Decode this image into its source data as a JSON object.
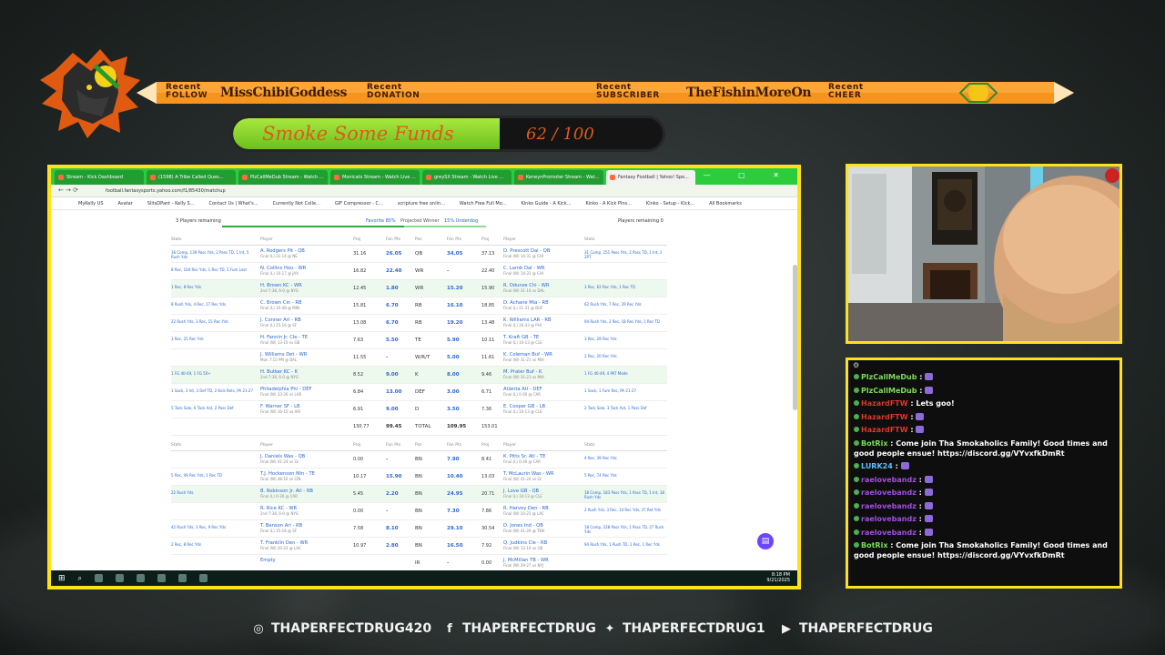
{
  "banner": {
    "follow_label": [
      "Recent",
      "FOLLOW"
    ],
    "follow_name": "MissChibiGoddess",
    "donation_label": [
      "Recent",
      "DONATION"
    ],
    "subscriber_label": [
      "Recent",
      "SUBSCRIBER"
    ],
    "subscriber_name": "TheFishinMoreOn",
    "cheer_label": [
      "Recent",
      "CHEER"
    ]
  },
  "goal": {
    "title": "Smoke Some Funds",
    "current": 62,
    "target": 100,
    "count_text": "62 / 100",
    "fill_fraction": 0.62
  },
  "browser": {
    "tabs": [
      "Stream - Kick Dashboard",
      "(1598) A Tribe Called Ques...",
      "PlzCallMeDub Stream - Watch ...",
      "Monicats Stream - Watch Live ...",
      "greySX Stream - Watch Live ...",
      "KerwynPromoter Stream - Wat...",
      "Fantasy Football | Yahoo! Spo..."
    ],
    "url": "football.fantasysports.yahoo.com/f1/85430/matchup",
    "bookmarks": [
      "MyKelly US",
      "Avatar",
      "SlitsDPant - Kelly S...",
      "Contact Us | What's...",
      "Currently Not Colle...",
      "GIF Compressor - C...",
      "scripture free onlin...",
      "Watch Free Full Mo...",
      "Kinko Guide - A Kick...",
      "Kinko - A Kick Plns...",
      "Kinko - Setup - Kick...",
      "All Bookmarks"
    ],
    "summary": {
      "left": "3 Players remaining",
      "favorite": "Favorite 85%",
      "projected": "Projected Winner",
      "underdog": "15% Underdog",
      "right": "Players remaining 0"
    },
    "headers": {
      "stats": "Stats",
      "player": "Player",
      "proj": "Proj",
      "fan_pts": "Fan Pts",
      "pos": "Pos"
    },
    "starters": [
      {
        "lstats": "16 Comp, 139 Pass Yds, 2 Pass TD, 1 Int, 5 Rush Yds",
        "lname": "A. Rodgers Pit - QB",
        "lgame": "Final (L) 21-14 @ NE",
        "lproj": "31.16",
        "lpts": "26.05",
        "pos": "QB",
        "rpts": "34.05",
        "rproj": "37.13",
        "rname": "D. Prescott Dal - QB",
        "rgame": "Final (W) 14-31 @ CHI",
        "rstats": "31 Comp, 251 Pass Yds, 2 Pass TD, 1 Int, 1 2PT"
      },
      {
        "lstats": "8 Rec, 104 Rec Yds, 1 Rec TD, 1 Fum Lost",
        "lname": "N. Collins Hou - WR",
        "lgame": "Final (L) 10-17 @ JAX",
        "lproj": "16.82",
        "lpts": "22.40",
        "pos": "WR",
        "rpts": "-",
        "rproj": "22.40",
        "rname": "C. Lamb Dal - WR",
        "rgame": "Final (W) 14-31 @ CHI",
        "rstats": ""
      },
      {
        "lstats": "1 Rec, 8 Rec Yds",
        "lname": "H. Brown KC - WR",
        "lgame": "2nd 7:38, 6-0 @ NYG",
        "lproj": "12.45",
        "lpts": "1.80",
        "pos": "WR",
        "rpts": "15.20",
        "rproj": "15.90",
        "rname": "R. Odunze Chi - WR",
        "rgame": "Final (W) 31-14 vs DAL",
        "rstats": "3 Rec, 62 Rec Yds, 1 Rec TD"
      },
      {
        "lstats": "8 Rush Yds, 4 Rec, 17 Rec Yds",
        "lname": "C. Brown Cin - RB",
        "lgame": "Final (L) 10-48 @ MIN",
        "lproj": "15.81",
        "lpts": "6.70",
        "pos": "RB",
        "rpts": "16.10",
        "rproj": "18.85",
        "rname": "D. Achane Mia - RB",
        "rgame": "Final (L) 21-31 @ BUF",
        "rstats": "62 Rush Yds, 7 Rec, 29 Rec Yds"
      },
      {
        "lstats": "22 Rush Yds, 3 Rec, 15 Rec Yds",
        "lname": "J. Conner Ari - RB",
        "lgame": "Final (L) 15-16 @ SF",
        "lproj": "13.08",
        "lpts": "6.70",
        "pos": "RB",
        "rpts": "19.20",
        "rproj": "13.48",
        "rname": "K. Williams LAR - RB",
        "rgame": "Final (L) 26-33 @ PHI",
        "rstats": "94 Rush Yds, 2 Rec, 18 Rec Yds, 1 Rec TD"
      },
      {
        "lstats": "3 Rec, 25 Rec Yds",
        "lname": "H. Fannin Jr. Cle - TE",
        "lgame": "Final (W) 13-10 vs GB",
        "lproj": "7.63",
        "lpts": "5.50",
        "pos": "TE",
        "rpts": "5.90",
        "rproj": "10.11",
        "rname": "T. Kraft GB - TE",
        "rgame": "Final (L) 10-13 @ CLE",
        "rstats": "3 Rec, 29 Rec Yds"
      },
      {
        "lstats": "",
        "lname": "J. Williams Det - WR",
        "lgame": "Mon 7:15 PM @ BAL",
        "lproj": "11.55",
        "lpts": "-",
        "pos": "W/R/T",
        "rpts": "5.00",
        "rproj": "11.61",
        "rname": "K. Coleman Buf - WR",
        "rgame": "Final (W) 31-21 vs MIA",
        "rstats": "2 Rec, 20 Rec Yds"
      },
      {
        "lstats": "1 FG 40-49, 1 FG 50+",
        "lname": "H. Butker KC - K",
        "lgame": "2nd 7:38, 6-0 @ NYG",
        "lproj": "8.52",
        "lpts": "9.00",
        "pos": "K",
        "rpts": "8.00",
        "rproj": "9.46",
        "rname": "M. Prater Buf - K",
        "rgame": "Final (W) 31-21 vs MIA",
        "rstats": "1 FG 40-49, 4 PAT Made"
      },
      {
        "lstats": "1 Sack, 3 Int, 3 Def TD, 2 Kick Rets, PA 21-27",
        "lname": "Philadelphia Phi - DEF",
        "lgame": "Final (W) 33-26 vs LAR",
        "lproj": "6.84",
        "lpts": "13.00",
        "pos": "DEF",
        "rpts": "3.00",
        "rproj": "6.71",
        "rname": "Atlanta Atl - DEF",
        "rgame": "Final (L) 0-30 @ CAR",
        "rstats": "1 Sack, 1 Fum Rec, PA 21-27"
      },
      {
        "lstats": "5 Tack Solo, 6 Tack Ast, 2 Pass Def",
        "lname": "F. Warner SF - LB",
        "lgame": "Final (W) 16-15 vs ARI",
        "lproj": "6.91",
        "lpts": "9.00",
        "pos": "D",
        "rpts": "3.50",
        "rproj": "7.36",
        "rname": "E. Cooper GB - LB",
        "rgame": "Final (L) 10-13 @ CLE",
        "rstats": "2 Tack Solo, 3 Tack Ast, 1 Pass Def"
      }
    ],
    "totals": {
      "lproj": "130.77",
      "lpts": "99.45",
      "label": "TOTAL",
      "rpts": "109.95",
      "rproj": "153.01"
    },
    "bench": [
      {
        "lstats": "",
        "lname": "J. Daniels Was - QB",
        "lgame": "Final (W) 41-24 vs LV",
        "lproj": "0.00",
        "lpts": "-",
        "pos": "BN",
        "rpts": "7.90",
        "rproj": "8.41",
        "rname": "K. Pitts Sr. Atl - TE",
        "rgame": "Final (L) 0-30 @ CAR",
        "rstats": "4 Rec, 39 Rec Yds"
      },
      {
        "lstats": "5 Rec, 49 Rec Yds, 1 Rec TD",
        "lname": "T.J. Hockenson Min - TE",
        "lgame": "Final (W) 48-10 vs CIN",
        "lproj": "10.17",
        "lpts": "15.90",
        "pos": "BN",
        "rpts": "10.40",
        "rproj": "13.03",
        "rname": "T. McLaurin Was - WR",
        "rgame": "Final (W) 41-24 vs LV",
        "rstats": "5 Rec, 74 Rec Yds"
      },
      {
        "lstats": "22 Rush Yds",
        "lname": "B. Robinson Jr. Atl - RB",
        "lgame": "Final (L) 0-30 @ CAR",
        "lproj": "5.45",
        "lpts": "2.20",
        "pos": "BN",
        "rpts": "24.95",
        "rproj": "20.71",
        "rname": "J. Love GB - QB",
        "rgame": "Final (L) 10-13 @ CLE",
        "rstats": "18 Comp, 183 Pass Yds, 1 Pass TD, 1 Int, 18 Rush Yds"
      },
      {
        "lstats": "",
        "lname": "R. Rice KC - WR",
        "lgame": "2nd 7:38, 6-0 @ NYG",
        "lproj": "0.00",
        "lpts": "-",
        "pos": "BN",
        "rpts": "7.30",
        "rproj": "7.86",
        "rname": "R. Harvey Den - RB",
        "rgame": "Final (W) 20-23 @ LAC",
        "rstats": "2 Rush Yds, 3 Rec, 14 Rec Yds, 27 Ret Yds"
      },
      {
        "lstats": "42 Rush Yds, 3 Rec, 9 Rec Yds",
        "lname": "T. Benson Ari - RB",
        "lgame": "Final (L) 15-16 @ SF",
        "lproj": "7.58",
        "lpts": "8.10",
        "pos": "BN",
        "rpts": "29.10",
        "rproj": "30.54",
        "rname": "D. Jones Ind - QB",
        "rgame": "Final (W) 41-20 @ TEN",
        "rstats": "18 Comp, 228 Pass Yds, 1 Pass TD, 27 Rush Yds"
      },
      {
        "lstats": "2 Rec, 8 Rec Yds",
        "lname": "T. Franklin Den - WR",
        "lgame": "Final (W) 20-23 @ LAC",
        "lproj": "10.97",
        "lpts": "2.80",
        "pos": "BN",
        "rpts": "16.50",
        "rproj": "7.92",
        "rname": "Q. Judkins Cle - RB",
        "rgame": "Final (W) 13-10 vs GB",
        "rstats": "94 Rush Yds, 1 Rush TD, 1 Rec, 1 Rec Yds"
      },
      {
        "lstats": "",
        "lname": "Empty",
        "lgame": "",
        "lproj": "",
        "lpts": "",
        "pos": "IR",
        "rpts": "-",
        "rproj": "0.00",
        "rname": "J. McMillan TB - WR",
        "rgame": "Final (W) 29-27 vs NYJ",
        "rstats": ""
      }
    ],
    "clock": {
      "time": "8:18 PM",
      "date": "9/21/2025"
    }
  },
  "chat": {
    "messages": [
      {
        "user": "PlzCallMeDub",
        "color": "#7ddc5a",
        "text": ""
      },
      {
        "user": "PlzCallMeDub",
        "color": "#7ddc5a",
        "text": ""
      },
      {
        "user": "HazardFTW",
        "color": "#e0362c",
        "text": "Lets goo!"
      },
      {
        "user": "HazardFTW",
        "color": "#e0362c",
        "text": ""
      },
      {
        "user": "HazardFTW",
        "color": "#e0362c",
        "text": ""
      },
      {
        "user": "BotRix",
        "color": "#7ddc5a",
        "text": "Come join Tha Smokaholics Family! Good times and good people ensue! https://discord.gg/VYvxfkDmRt"
      },
      {
        "user": "LURK24",
        "color": "#5ac0ff",
        "text": ""
      },
      {
        "user": "raelovebandz",
        "color": "#a04fe0",
        "text": ""
      },
      {
        "user": "raelovebandz",
        "color": "#a04fe0",
        "text": ""
      },
      {
        "user": "raelovebandz",
        "color": "#a04fe0",
        "text": ""
      },
      {
        "user": "raelovebandz",
        "color": "#a04fe0",
        "text": ""
      },
      {
        "user": "raelovebandz",
        "color": "#a04fe0",
        "text": ""
      },
      {
        "user": "BotRix",
        "color": "#7ddc5a",
        "text": "Come join Tha Smokaholics Family! Good times and good people ensue! https://discord.gg/VYvxfkDmRt"
      }
    ]
  },
  "socials": [
    {
      "icon": "instagram-icon",
      "handle": "THAPERFECTDRUG420"
    },
    {
      "icon": "facebook-icon",
      "handle": "THAPERFECTDRUG"
    },
    {
      "icon": "twitter-icon",
      "handle": "THAPERFECTDRUG1"
    },
    {
      "icon": "youtube-icon",
      "handle": "THAPERFECTDRUG"
    }
  ],
  "colors": {
    "frame": "#ffe11a",
    "goal_fill": "#8fd52c",
    "goal_text": "#e05a1a",
    "banner": "#f07a1e",
    "tabbar": "#2dcc3d"
  }
}
